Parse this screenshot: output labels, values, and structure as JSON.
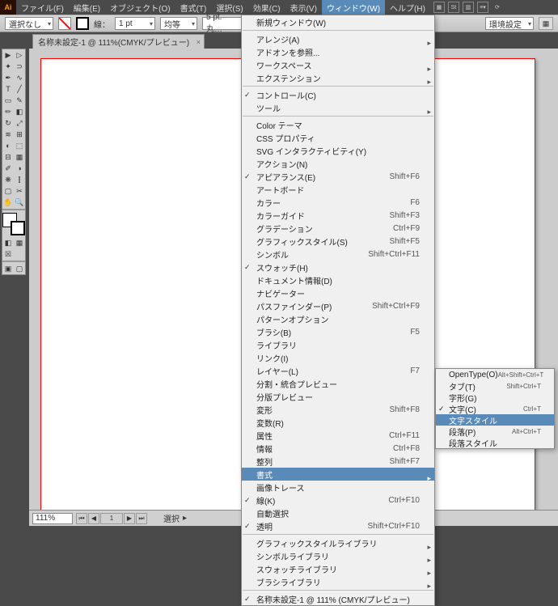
{
  "menubar": {
    "items": [
      "ファイル(F)",
      "編集(E)",
      "オブジェクト(O)",
      "書式(T)",
      "選択(S)",
      "効果(C)",
      "表示(V)",
      "ウィンドウ(W)",
      "ヘルプ(H)"
    ],
    "open_index": 7
  },
  "optionbar": {
    "no_selection": "選択なし",
    "stroke_label": "線：",
    "stroke_weight": "1 pt",
    "uniform": "均等",
    "pt_round": "5 pt. 丸…",
    "preferences": "環境設定"
  },
  "tab": {
    "title": "名称未設定-1 @ 111%(CMYK/プレビュー)"
  },
  "dropdown": [
    {
      "label": "新規ウィンドウ(W)"
    },
    {
      "sep": true
    },
    {
      "label": "アレンジ(A)",
      "sub": true
    },
    {
      "label": "アドオンを参照..."
    },
    {
      "label": "ワークスペース",
      "sub": true
    },
    {
      "label": "エクステンション",
      "sub": true
    },
    {
      "sep": true
    },
    {
      "label": "コントロール(C)",
      "check": true
    },
    {
      "label": "ツール",
      "sub": true
    },
    {
      "sep": true
    },
    {
      "label": "Color テーマ"
    },
    {
      "label": "CSS プロパティ"
    },
    {
      "label": "SVG インタラクティビティ(Y)"
    },
    {
      "label": "アクション(N)"
    },
    {
      "label": "アピアランス(E)",
      "check": true,
      "sc": "Shift+F6"
    },
    {
      "label": "アートボード"
    },
    {
      "label": "カラー",
      "sc": "F6"
    },
    {
      "label": "カラーガイド",
      "sc": "Shift+F3"
    },
    {
      "label": "グラデーション",
      "sc": "Ctrl+F9"
    },
    {
      "label": "グラフィックスタイル(S)",
      "sc": "Shift+F5"
    },
    {
      "label": "シンボル",
      "sc": "Shift+Ctrl+F11"
    },
    {
      "label": "スウォッチ(H)",
      "check": true
    },
    {
      "label": "ドキュメント情報(D)"
    },
    {
      "label": "ナビゲーター"
    },
    {
      "label": "パスファインダー(P)",
      "sc": "Shift+Ctrl+F9"
    },
    {
      "label": "パターンオプション"
    },
    {
      "label": "ブラシ(B)",
      "sc": "F5"
    },
    {
      "label": "ライブラリ"
    },
    {
      "label": "リンク(I)"
    },
    {
      "label": "レイヤー(L)",
      "sc": "F7"
    },
    {
      "label": "分割・統合プレビュー"
    },
    {
      "label": "分版プレビュー"
    },
    {
      "label": "変形",
      "sc": "Shift+F8"
    },
    {
      "label": "変数(R)"
    },
    {
      "label": "属性",
      "sc": "Ctrl+F11"
    },
    {
      "label": "情報",
      "sc": "Ctrl+F8"
    },
    {
      "label": "整列",
      "sc": "Shift+F7"
    },
    {
      "label": "書式",
      "sub": true,
      "hl": true
    },
    {
      "label": "画像トレース"
    },
    {
      "label": "線(K)",
      "check": true,
      "sc": "Ctrl+F10"
    },
    {
      "label": "自動選択"
    },
    {
      "label": "透明",
      "check": true,
      "sc": "Shift+Ctrl+F10"
    },
    {
      "sep": true
    },
    {
      "label": "グラフィックスタイルライブラリ",
      "sub": true
    },
    {
      "label": "シンボルライブラリ",
      "sub": true
    },
    {
      "label": "スウォッチライブラリ",
      "sub": true
    },
    {
      "label": "ブラシライブラリ",
      "sub": true
    },
    {
      "sep": true
    },
    {
      "label": "名称未設定-1 @ 111% (CMYK/プレビュー)",
      "check": true
    }
  ],
  "submenu": [
    {
      "label": "OpenType(O)",
      "sc": "Alt+Shift+Ctrl+T"
    },
    {
      "label": "タブ(T)",
      "sc": "Shift+Ctrl+T"
    },
    {
      "label": "字形(G)"
    },
    {
      "label": "文字(C)",
      "check": true,
      "sc": "Ctrl+T"
    },
    {
      "label": "文字スタイル",
      "hl": true
    },
    {
      "label": "段落(P)",
      "sc": "Alt+Ctrl+T"
    },
    {
      "label": "段落スタイル"
    }
  ],
  "status": {
    "zoom": "111%",
    "info": "選択"
  }
}
